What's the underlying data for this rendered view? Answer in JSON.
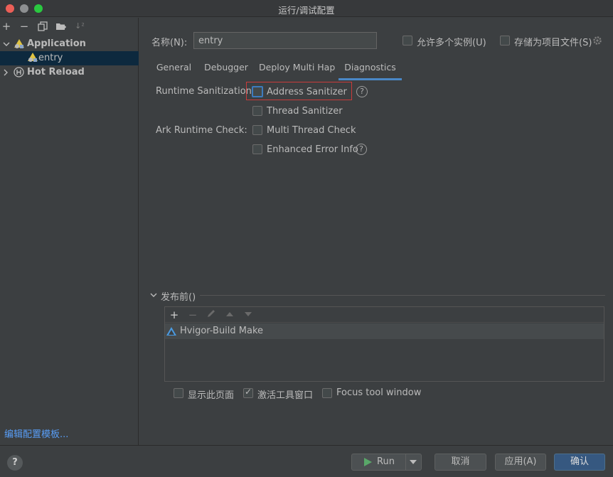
{
  "window": {
    "title": "运行/调试配置"
  },
  "sidebar": {
    "toolbar": {
      "add_symbol": "+",
      "remove_symbol": "−",
      "sort_symbol": "↓²"
    },
    "tree": {
      "application_label": "Application",
      "entry_label": "entry",
      "hot_reload_label": "Hot Reload"
    },
    "edit_templates_link": "编辑配置模板..."
  },
  "header": {
    "name_label": "名称(N):",
    "name_value": "entry",
    "allow_multiple_label": "允许多个实例(U)",
    "store_as_project_label": "存储为项目文件(S)"
  },
  "tabs": [
    {
      "label": "General"
    },
    {
      "label": "Debugger"
    },
    {
      "label": "Deploy Multi Hap"
    },
    {
      "label": "Diagnostics"
    }
  ],
  "diagnostics": {
    "runtime_sanitization_label": "Runtime Sanitization:",
    "address_sanitizer_label": "Address Sanitizer",
    "thread_sanitizer_label": "Thread Sanitizer",
    "ark_runtime_check_label": "Ark Runtime Check:",
    "multi_thread_check_label": "Multi Thread Check",
    "enhanced_error_info_label": "Enhanced Error Info",
    "help_symbol": "?"
  },
  "before_launch": {
    "section_label": "发布前()",
    "toolbar": {
      "add_symbol": "+",
      "remove_symbol": "−"
    },
    "items": [
      {
        "label": "Hvigor-Build Make"
      }
    ],
    "show_page_label": "显示此页面",
    "activate_tool_window_label": "激活工具窗口",
    "focus_tool_window_label": "Focus tool window"
  },
  "footer": {
    "help_symbol": "?",
    "run_label": "Run",
    "cancel_label": "取消",
    "apply_label": "应用(A)",
    "ok_label": "确认"
  },
  "colors": {
    "accent": "#4a88c7",
    "primary_button": "#365880",
    "link": "#589df6",
    "highlight_box": "#c93b3b",
    "run_icon": "#59a869"
  }
}
